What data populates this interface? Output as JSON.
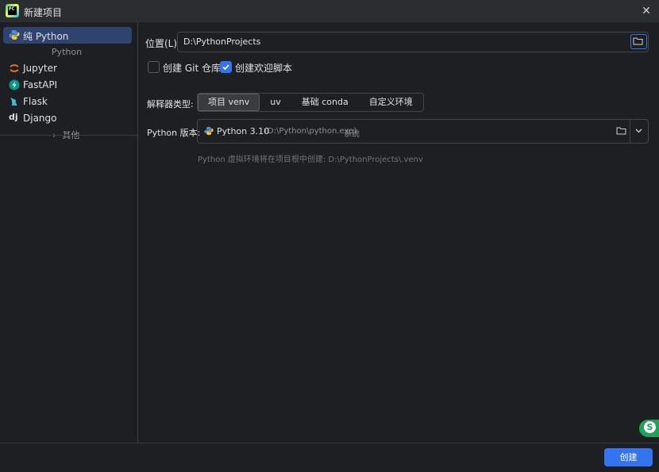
{
  "window": {
    "title": "新建项目"
  },
  "sidebar": {
    "items": [
      {
        "label": "纯 Python",
        "icon": "python-icon"
      },
      {
        "label": "Jupyter",
        "icon": "jupyter-icon"
      },
      {
        "label": "FastAPI",
        "icon": "fastapi-icon"
      },
      {
        "label": "Flask",
        "icon": "flask-icon"
      },
      {
        "label": "Django",
        "icon": "django-icon"
      }
    ],
    "group_header": "Python",
    "more_label": "其他"
  },
  "form": {
    "location_label": "位置(L):",
    "location_value": "D:\\PythonProjects",
    "git_checkbox": {
      "label": "创建 Git 仓库",
      "checked": false
    },
    "welcome_checkbox": {
      "label": "创建欢迎脚本",
      "checked": true
    },
    "interpreter_label": "解释器类型:",
    "interpreter_options": [
      "项目 venv",
      "uv",
      "基础 conda",
      "自定义环境"
    ],
    "interpreter_selected": "项目 venv",
    "version_label": "Python 版本:",
    "version_value": "Python 3.10",
    "version_path": "(D:\\Python\\python.exe)",
    "version_tag": "系统",
    "hint": "Python 虚拟环境将在项目根中创建: D:\\PythonProjects\\.venv"
  },
  "footer": {
    "create_label": "创建"
  },
  "badge": {
    "letter": "S"
  },
  "colors": {
    "accent": "#3574f0",
    "selection": "#2e436e",
    "background": "#1e1f22"
  }
}
